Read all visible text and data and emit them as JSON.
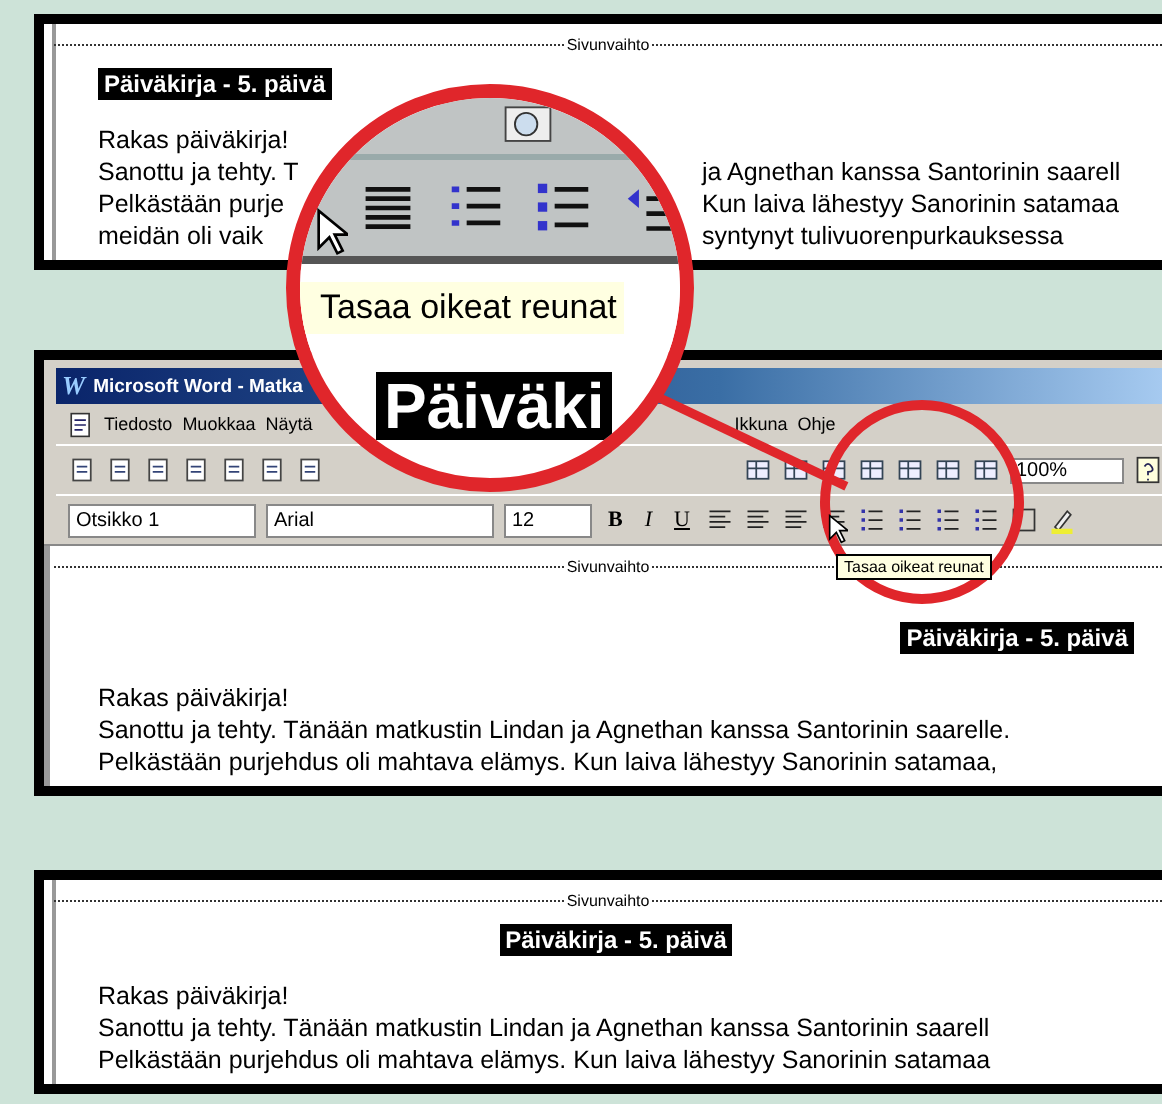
{
  "panels": [
    {
      "kind": "document_left",
      "page_break": "Sivunvaihto",
      "heading": "Päiväkirja - 5. päivä",
      "lines": [
        {
          "left": "Rakas päiväkirja!"
        },
        {
          "left": "Sanottu ja tehty. T",
          "right": "ja Agnethan kanssa Santorinin saarell"
        },
        {
          "left": "Pelkästään purje",
          "right": "Kun laiva lähestyy Sanorinin satamaa"
        },
        {
          "left": "meidän oli vaik",
          "right": "syntynyt tulivuorenpurkauksessa"
        }
      ]
    },
    {
      "kind": "word_window",
      "logo": "W",
      "title": "Microsoft Word - Matka",
      "menu_left": [
        "Tiedosto",
        "Muokkaa",
        "Näytä"
      ],
      "menu_right": [
        "Ikkuna",
        "Ohje"
      ],
      "zoom": "100%",
      "style": "Otsikko 1",
      "font": "Arial",
      "size": "12",
      "format_buttons": [
        "B",
        "I",
        "U"
      ],
      "tooltip": "Tasaa oikeat reunat",
      "page_break": "Sivunvaihto",
      "heading": "Päiväkirja - 5. päivä",
      "lines": [
        {
          "left": "Rakas päiväkirja!"
        },
        {
          "left": "Sanottu ja tehty. Tänään matkustin Lindan ja Agnethan kanssa Santorinin saarelle."
        },
        {
          "left": "Pelkästään purjehdus oli mahtava elämys. Kun laiva lähestyy Sanorinin satamaa,"
        }
      ]
    },
    {
      "kind": "document_centered",
      "page_break": "Sivunvaihto",
      "heading": "Päiväkirja - 5. päivä",
      "lines": [
        {
          "left": "Rakas päiväkirja!"
        },
        {
          "left": "Sanottu ja tehty. Tänään matkustin Lindan ja Agnethan kanssa Santorinin saarell"
        },
        {
          "left": "Pelkästään purjehdus oli mahtava elämys. Kun laiva lähestyy Sanorinin satamaa"
        }
      ]
    }
  ],
  "magnifier": {
    "tooltip": "Tasaa oikeat reunat",
    "heading_fragment": "Päiväki"
  }
}
